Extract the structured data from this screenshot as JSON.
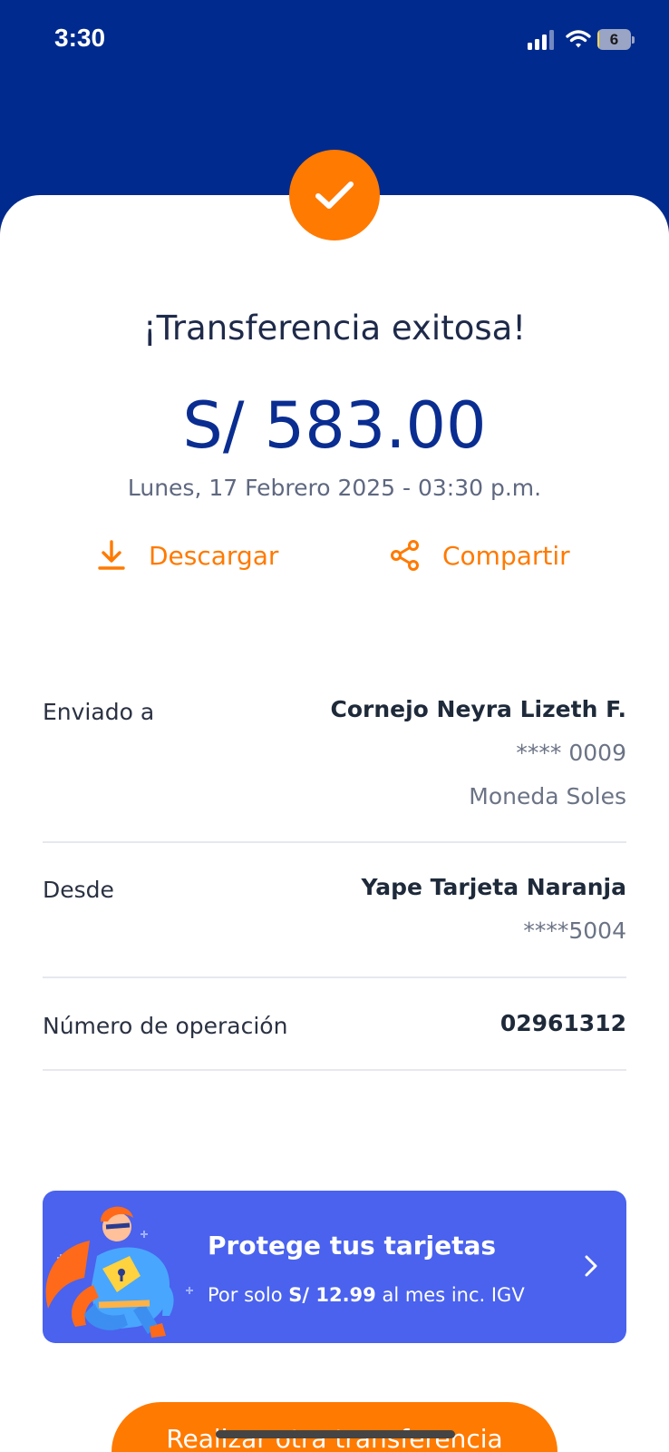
{
  "status_bar": {
    "time": "3:30",
    "battery_level": "6",
    "battery_fraction": 0.06
  },
  "receipt": {
    "title": "¡Transferencia exitosa!",
    "amount": "S/ 583.00",
    "datetime": "Lunes, 17 Febrero 2025 - 03:30 p.m.",
    "actions": {
      "download_label": "Descargar",
      "share_label": "Compartir"
    }
  },
  "details": {
    "sent_to": {
      "label": "Enviado a",
      "name": "Cornejo Neyra Lizeth F.",
      "account": "**** 0009",
      "currency": "Moneda Soles"
    },
    "from": {
      "label": "Desde",
      "name": "Yape Tarjeta Naranja",
      "card": "****5004"
    },
    "operation": {
      "label": "Número de operación",
      "number": "02961312"
    }
  },
  "promo": {
    "title": "Protege tus tarjetas",
    "sub_prefix": "Por solo",
    "sub_price": "S/ 12.99",
    "sub_suffix": "al mes inc. IGV"
  },
  "bottom_button": {
    "label": "Realizar otra transferencia"
  },
  "colors": {
    "header_blue": "#002a8d",
    "amount_blue": "#0a2d91",
    "accent_orange": "#ff7a00",
    "promo_blue": "#4a62ee"
  }
}
